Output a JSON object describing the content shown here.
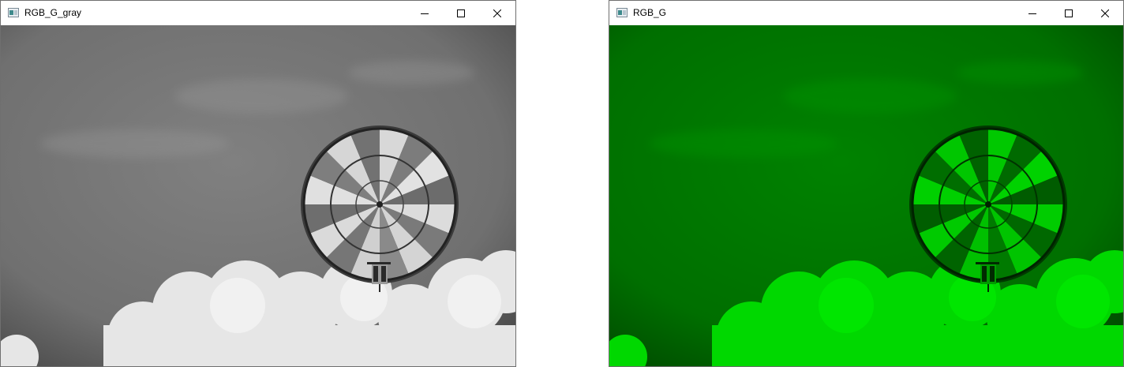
{
  "windows": [
    {
      "title": "RGB_G_gray",
      "controls": {
        "minimize_icon": "minimize-icon",
        "maximize_icon": "maximize-icon",
        "close_icon": "close-icon"
      },
      "image": {
        "description_color_mode": "grayscale",
        "sky_color": "#7a7a7a",
        "cloud_color": "#e8e8e8"
      }
    },
    {
      "title": "RGB_G",
      "controls": {
        "minimize_icon": "minimize-icon",
        "maximize_icon": "maximize-icon",
        "close_icon": "close-icon"
      },
      "image": {
        "description_color_mode": "green channel",
        "sky_color": "#007a00",
        "cloud_color": "#00e000"
      }
    }
  ]
}
